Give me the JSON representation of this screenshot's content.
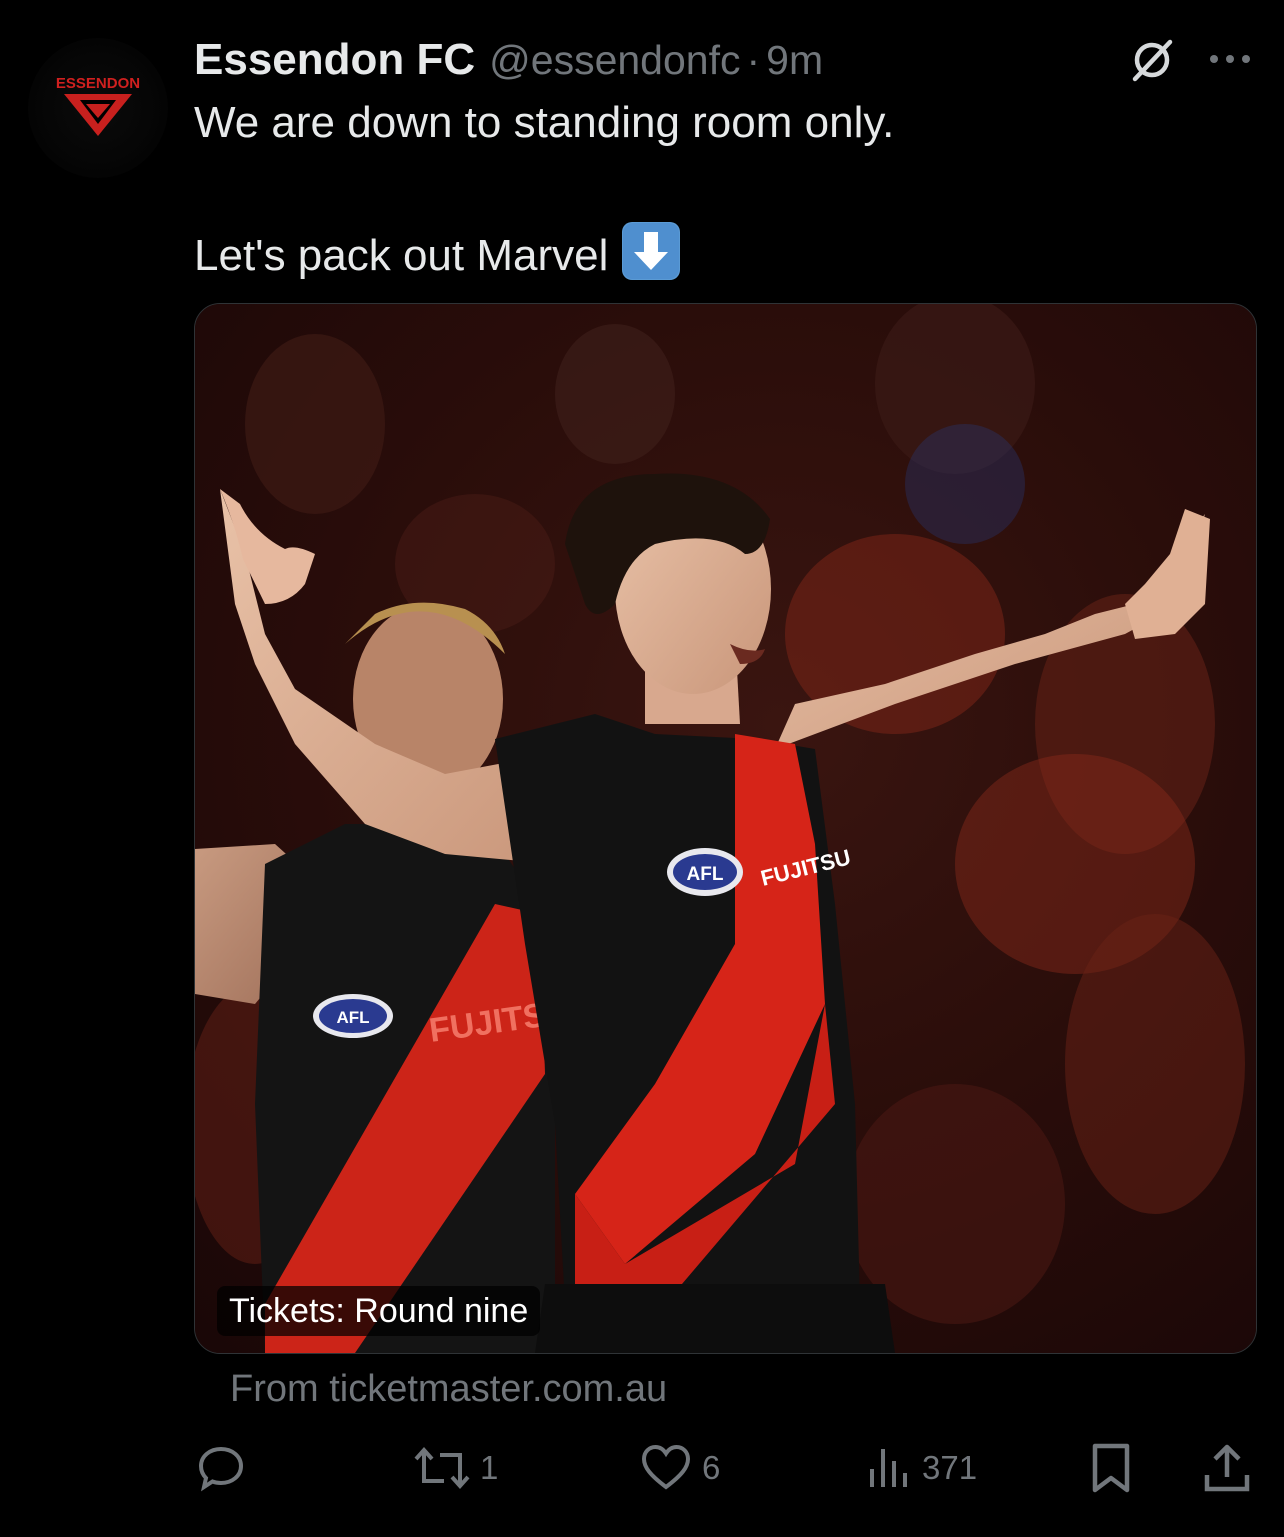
{
  "tweet": {
    "author_name": "Essendon FC",
    "handle": "@essendonfc",
    "separator": "·",
    "time": "9m",
    "avatar_text": "ESSENDON",
    "text_line1": "We are down to standing room only.",
    "text_line2": "Let's pack out Marvel",
    "emoji_name": "down-arrow-emoji"
  },
  "card": {
    "badge": "Tickets: Round nine",
    "source": "From ticketmaster.com.au"
  },
  "actions": {
    "replies": "",
    "retweets": "1",
    "likes": "6",
    "views": "371"
  },
  "colors": {
    "background": "#000000",
    "text": "#e7e9ea",
    "muted": "#71767b",
    "essendon_red": "#cc2031"
  }
}
